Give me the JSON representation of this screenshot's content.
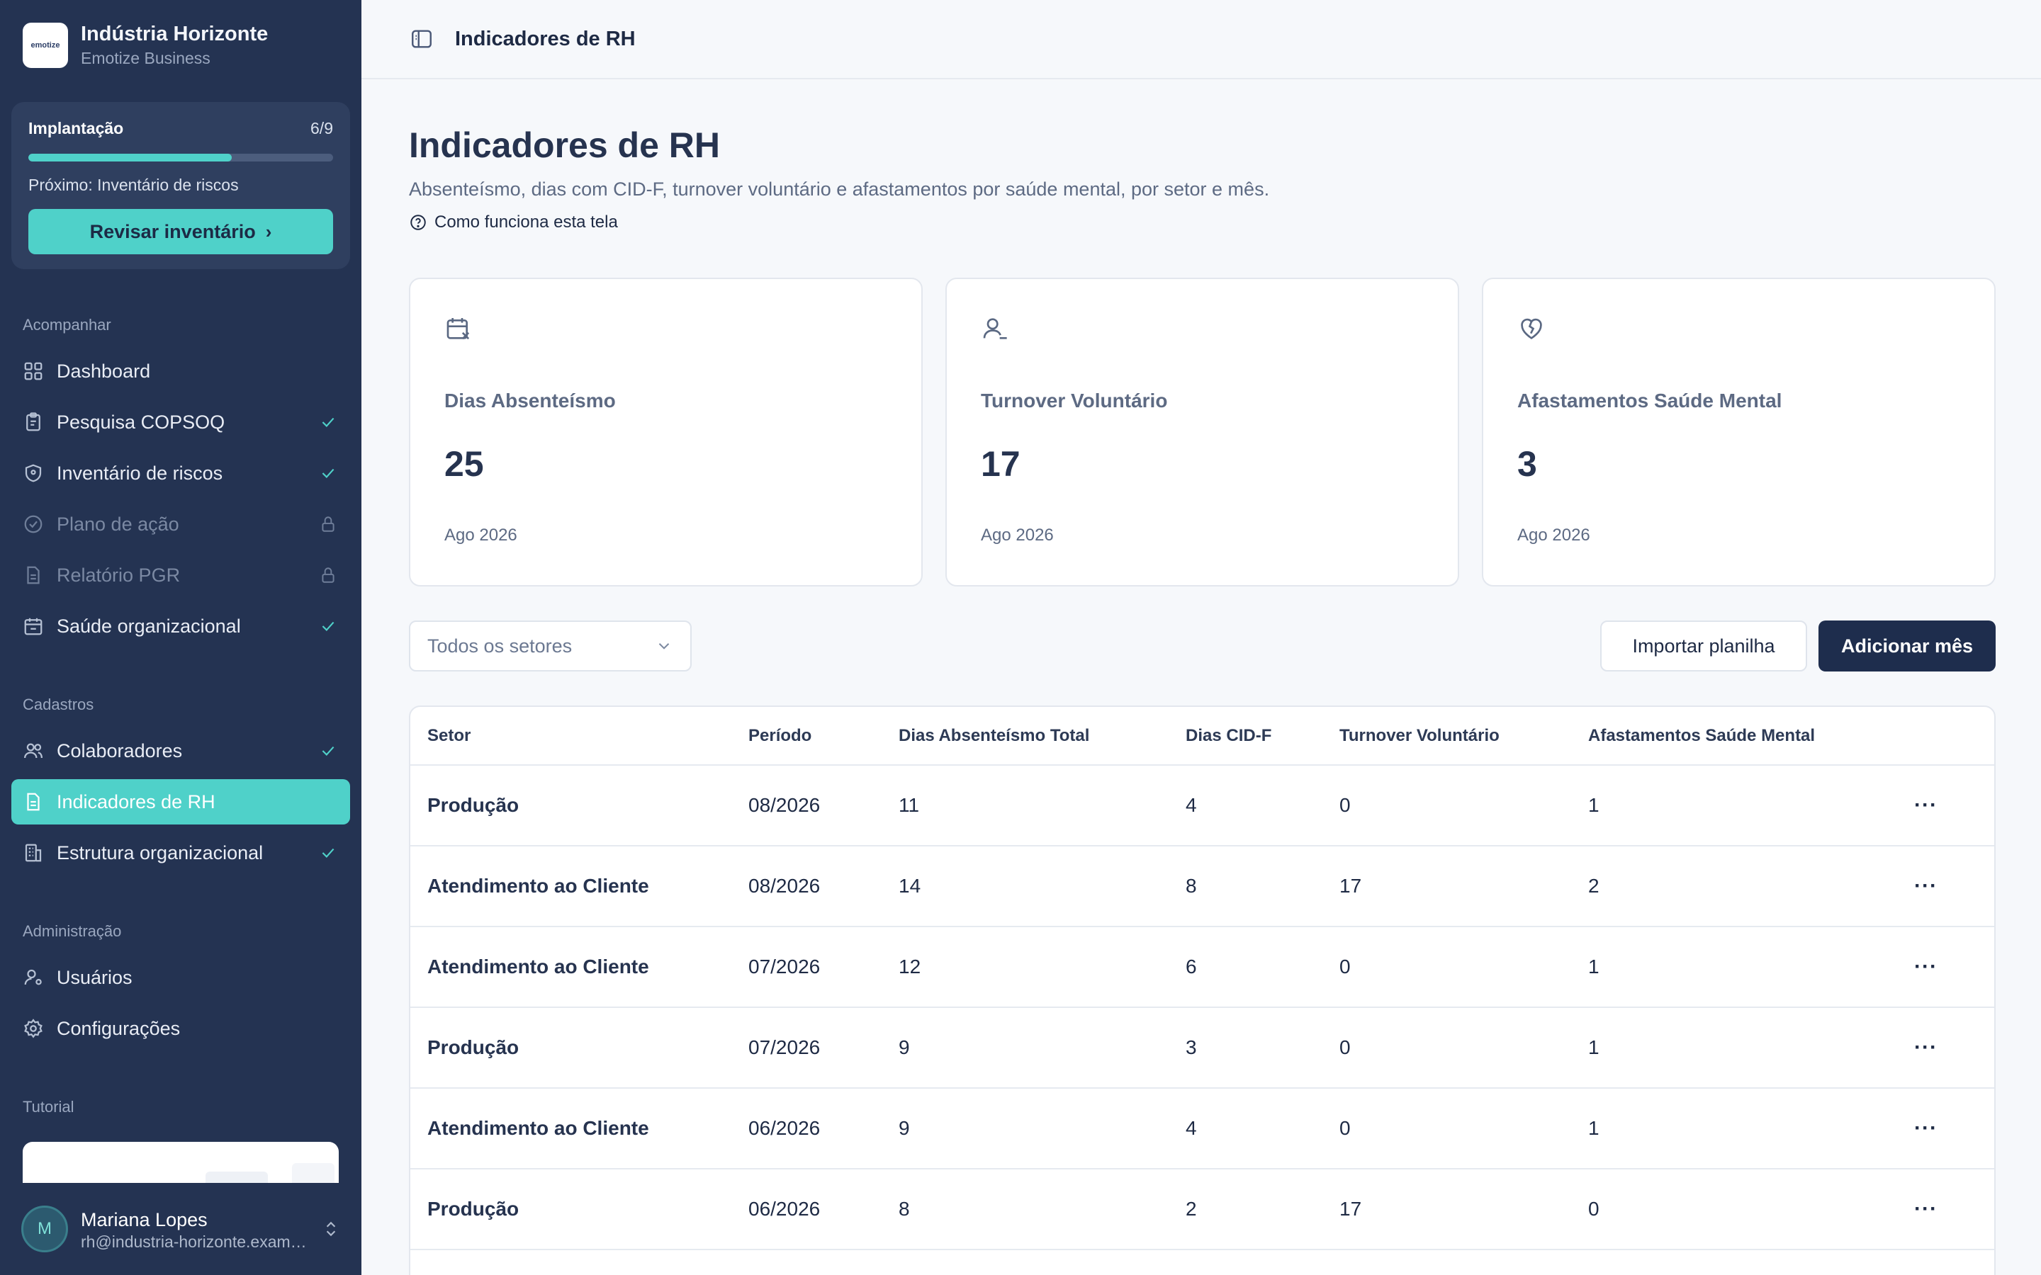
{
  "org": {
    "name": "Indústria Horizonte",
    "subtitle": "Emotize Business",
    "logo_text": "emotize"
  },
  "implantacao": {
    "title": "Implantação",
    "count": "6/9",
    "progress": 0.667,
    "next": "Próximo: Inventário de riscos",
    "button": "Revisar inventário"
  },
  "nav": {
    "section_acompanhar": "Acompanhar",
    "section_cadastros": "Cadastros",
    "section_admin": "Administração",
    "section_tutorial": "Tutorial",
    "dashboard": "Dashboard",
    "copsoq": "Pesquisa COPSOQ",
    "inventario": "Inventário de riscos",
    "plano": "Plano de ação",
    "relatorio": "Relatório PGR",
    "saude": "Saúde organizacional",
    "colaboradores": "Colaboradores",
    "indicadores": "Indicadores de RH",
    "estrutura": "Estrutura organizacional",
    "usuarios": "Usuários",
    "configuracoes": "Configurações"
  },
  "user": {
    "initial": "M",
    "name": "Mariana Lopes",
    "email": "rh@industria-horizonte.example.com"
  },
  "topbar": {
    "breadcrumb": "Indicadores de RH"
  },
  "page": {
    "title": "Indicadores de RH",
    "description": "Absenteísmo, dias com CID-F, turnover voluntário e afastamentos por saúde mental, por setor e mês.",
    "help": "Como funciona esta tela"
  },
  "kpis": [
    {
      "title": "Dias Absenteísmo",
      "value": "25",
      "period": "Ago 2026",
      "icon": "calendar-x-icon"
    },
    {
      "title": "Turnover Voluntário",
      "value": "17",
      "period": "Ago 2026",
      "icon": "user-minus-icon"
    },
    {
      "title": "Afastamentos Saúde Mental",
      "value": "3",
      "period": "Ago 2026",
      "icon": "heart-broken-icon"
    }
  ],
  "filter": {
    "sector_selected": "Todos os setores"
  },
  "actions": {
    "import": "Importar planilha",
    "add": "Adicionar mês"
  },
  "table": {
    "headers": [
      "Setor",
      "Período",
      "Dias Absenteísmo Total",
      "Dias CID-F",
      "Turnover Voluntário",
      "Afastamentos Saúde Mental",
      ""
    ],
    "rows": [
      [
        "Produção",
        "08/2026",
        "11",
        "4",
        "0",
        "1"
      ],
      [
        "Atendimento ao Cliente",
        "08/2026",
        "14",
        "8",
        "17",
        "2"
      ],
      [
        "Atendimento ao Cliente",
        "07/2026",
        "12",
        "6",
        "0",
        "1"
      ],
      [
        "Produção",
        "07/2026",
        "9",
        "3",
        "0",
        "1"
      ],
      [
        "Atendimento ao Cliente",
        "06/2026",
        "9",
        "4",
        "0",
        "1"
      ],
      [
        "Produção",
        "06/2026",
        "8",
        "2",
        "17",
        "0"
      ]
    ],
    "row_menu": "···"
  },
  "colors": {
    "sidebar": "#243352",
    "accent": "#4fd1c9",
    "primary_button": "#1e2d4d"
  }
}
